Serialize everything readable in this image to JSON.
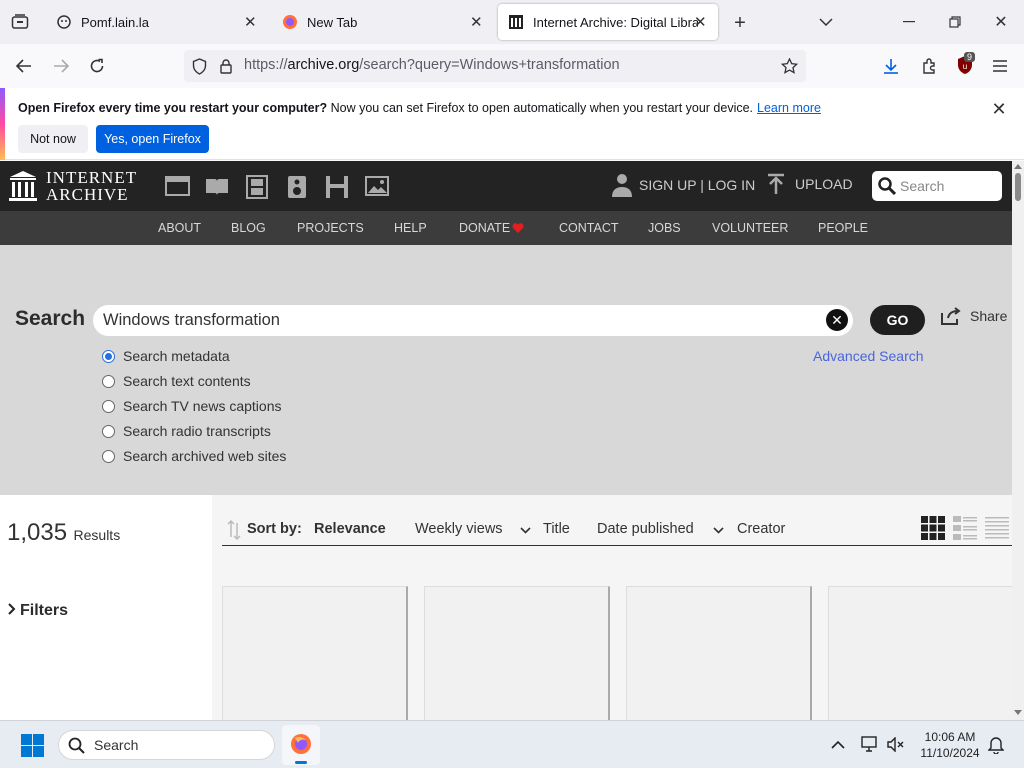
{
  "browser": {
    "tabs": [
      {
        "title": "Pomf.lain.la"
      },
      {
        "title": "New Tab"
      },
      {
        "title": "Internet Archive: Digital Library"
      }
    ],
    "url_prefix": "https://",
    "url_domain": "archive.org",
    "url_path": "/search?query=Windows+transformation",
    "extension_badge": "9"
  },
  "notification": {
    "bold": "Open Firefox every time you restart your computer?",
    "text": " Now you can set Firefox to open automatically when you restart your device.",
    "link": "Learn more",
    "secondary_button": "Not now",
    "primary_button": "Yes, open Firefox"
  },
  "ia": {
    "logo_line1": "INTERNET",
    "logo_line2": "ARCHIVE",
    "user_links": "SIGN UP | LOG IN",
    "upload": "UPLOAD",
    "search_placeholder": "Search",
    "nav": [
      "ABOUT",
      "BLOG",
      "PROJECTS",
      "HELP",
      "DONATE",
      "CONTACT",
      "JOBS",
      "VOLUNTEER",
      "PEOPLE"
    ]
  },
  "search": {
    "label": "Search",
    "query": "Windows transformation",
    "go": "GO",
    "share": "Share",
    "advanced": "Advanced Search",
    "options": [
      "Search metadata",
      "Search text contents",
      "Search TV news captions",
      "Search radio transcripts",
      "Search archived web sites"
    ],
    "selected_option": "Search metadata"
  },
  "results": {
    "count": "1,035",
    "count_label": "Results",
    "filters": "Filters",
    "sort_label": "Sort by:",
    "sort_options": [
      "Relevance",
      "Weekly views",
      "Title",
      "Date published",
      "Creator"
    ],
    "active_sort": "Relevance"
  },
  "taskbar": {
    "search_placeholder": "Search",
    "time": "10:06 AM",
    "date": "11/10/2024"
  },
  "colors": {
    "firefox_blue": "#0061e0",
    "ia_dark": "#232323",
    "ia_nav": "#3c3c3c",
    "link_blue": "#4b64de",
    "donate_heart": "#e02020"
  }
}
